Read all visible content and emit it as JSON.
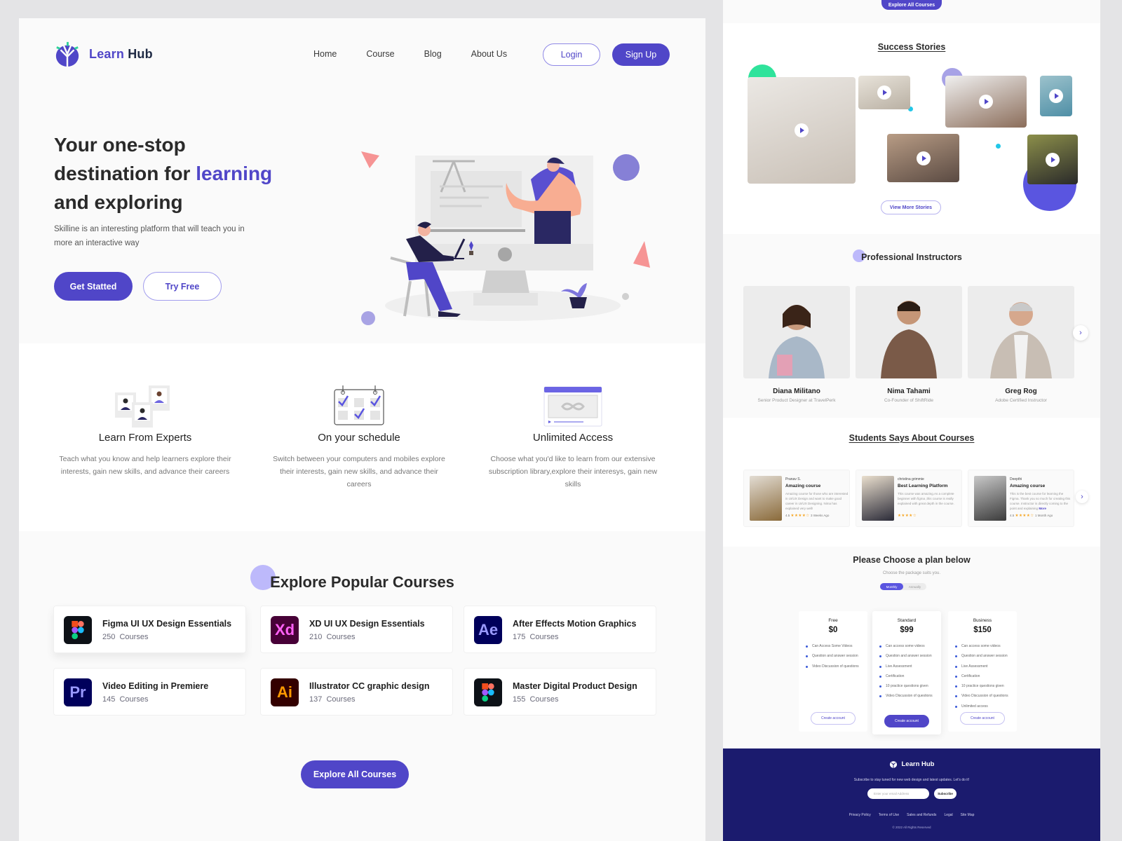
{
  "brand": {
    "name_part1": "Learn",
    "name_part2": "Hub",
    "accent_color": "#5046c8",
    "footer_color": "#1b1b6e"
  },
  "nav": {
    "links": [
      "Home",
      "Course",
      "Blog",
      "About Us"
    ],
    "login_label": "Login",
    "signup_label": "Sign Up"
  },
  "hero": {
    "title_line1": "Your one-stop",
    "title_line2_prefix": "destination for ",
    "title_accent": "learning",
    "title_line3": "and exploring",
    "subtitle": "Skilline is an interesting platform that will teach you in more an interactive way",
    "primary_cta": "Get Statted",
    "secondary_cta": "Try Free",
    "illustration": "online-class-illustration"
  },
  "features": [
    {
      "icon": "experts-profiles-icon",
      "title": "Learn From Experts",
      "text": "Teach what you know and help learners explore their interests, gain new skills, and advance their careers"
    },
    {
      "icon": "calendar-checks-icon",
      "title": "On your schedule",
      "text": "Switch between your computers and mobiles explore their interests, gain new skills, and advance their careers"
    },
    {
      "icon": "infinity-browser-icon",
      "title": "Unlimited Access",
      "text": "Choose what you'd like to learn from our extensive subscription library,explore their interesys, gain new skills"
    }
  ],
  "courses": {
    "title": "Explore Popular  Courses",
    "items": [
      {
        "name": "Figma UI UX Design Essentials",
        "count": "250",
        "unit": "Courses",
        "icon": "figma",
        "icon_text": "",
        "icon_bg": "#0d1117",
        "icon_fg": "#ffffff"
      },
      {
        "name": "XD UI UX Design Essentials",
        "count": "210",
        "unit": "Courses",
        "icon": "adobe-xd",
        "icon_text": "Xd",
        "icon_bg": "#470137",
        "icon_fg": "#ff61f6"
      },
      {
        "name": "After Effects Motion Graphics",
        "count": "175",
        "unit": "Courses",
        "icon": "adobe-after-effects",
        "icon_text": "Ae",
        "icon_bg": "#00005b",
        "icon_fg": "#9999ff"
      },
      {
        "name": "Video Editing in Premiere",
        "count": "145",
        "unit": "Courses",
        "icon": "adobe-premiere",
        "icon_text": "Pr",
        "icon_bg": "#00005b",
        "icon_fg": "#9999ff"
      },
      {
        "name": "Illustrator CC graphic design",
        "count": "137",
        "unit": "Courses",
        "icon": "adobe-illustrator",
        "icon_text": "Ai",
        "icon_bg": "#330000",
        "icon_fg": "#ff9a00"
      },
      {
        "name": "Master Digital Product Design",
        "count": "155",
        "unit": "Courses",
        "icon": "figma",
        "icon_text": "",
        "icon_bg": "#0d1117",
        "icon_fg": "#ffffff"
      }
    ],
    "explore_label": "Explore All Courses"
  },
  "success_stories": {
    "title": "Success Stories",
    "view_more_label": "View More Stories",
    "videos": [
      "story-video-1",
      "story-video-2",
      "story-video-3",
      "story-video-4",
      "story-video-5",
      "story-video-6"
    ]
  },
  "instructors": {
    "title": "Professional Instructors",
    "items": [
      {
        "name": "Diana Militano",
        "role": "Senior Product Designer at TravelPerk"
      },
      {
        "name": "Nima Tahami",
        "role": "Co-Founder of ShiftRide"
      },
      {
        "name": "Greg Rog",
        "role": "Adobe Certified Instructor"
      }
    ]
  },
  "reviews": {
    "title": "Students Says About Courses",
    "items": [
      {
        "author": "Pranav S.",
        "title": "Amazing course",
        "text": "Amazing course for those who are interested in UI/UX Design and want to make good career in UI/UX Designing. Nima has explained very well!",
        "rating": "4.5",
        "stars": "★★★★☆",
        "time": "3 Weeks Ago"
      },
      {
        "author": "christina grimmie",
        "title": "Best Learning Platform",
        "text": "This course was amazing.As a complete beginner with figma ,this course is really explained with great depth in the course.",
        "rating": "",
        "stars": "★★★★☆",
        "time": ""
      },
      {
        "author": "Deepthi",
        "title": "Amazing course",
        "text": "This is the best course for learning the Figma. Thank you so much for creating this course. Instructor is directly coming to the point and explaining",
        "more": "More",
        "rating": "4.5",
        "stars": "★★★★☆",
        "time": "1 Month Ago"
      }
    ]
  },
  "pricing": {
    "title": "Please Choose a  plan below",
    "subtitle": "Choose the package suits you.",
    "toggle": {
      "monthly": "Monthly",
      "annually": "Annually",
      "selected": "Monthly"
    },
    "plans": [
      {
        "name": "Free",
        "price": "$0",
        "features": [
          "Can Access Some Videos",
          "Question and answer session",
          "Video Discussion of questions"
        ],
        "cta": "Create account"
      },
      {
        "name": "Standard",
        "price": "$99",
        "features": [
          "Can access some videos",
          "Question and answer session",
          "Live Assessment",
          "Certification",
          "10 practice questions given",
          "Video Discussion of questions"
        ],
        "cta": "Create account"
      },
      {
        "name": "Business",
        "price": "$150",
        "features": [
          "Can access some videos",
          "Question and answer session",
          "Live Assessment",
          "Certification",
          "10 practice questions given",
          "Video Discussion of questions",
          "Unlimited access"
        ],
        "cta": "Create account"
      }
    ]
  },
  "footer": {
    "brand": "Learn Hub",
    "subscribe_text": "Subscribe to stay tuned for new web design and latest updates. Let's do it!",
    "email_placeholder": "Enter your email Address",
    "subscribe_label": "Subscribe",
    "links": [
      "Privacy Policy",
      "Terms of Use",
      "Sales and Refunds",
      "Legal",
      "Site Map"
    ],
    "copyright": "© 2022 All Rights Reserved"
  }
}
